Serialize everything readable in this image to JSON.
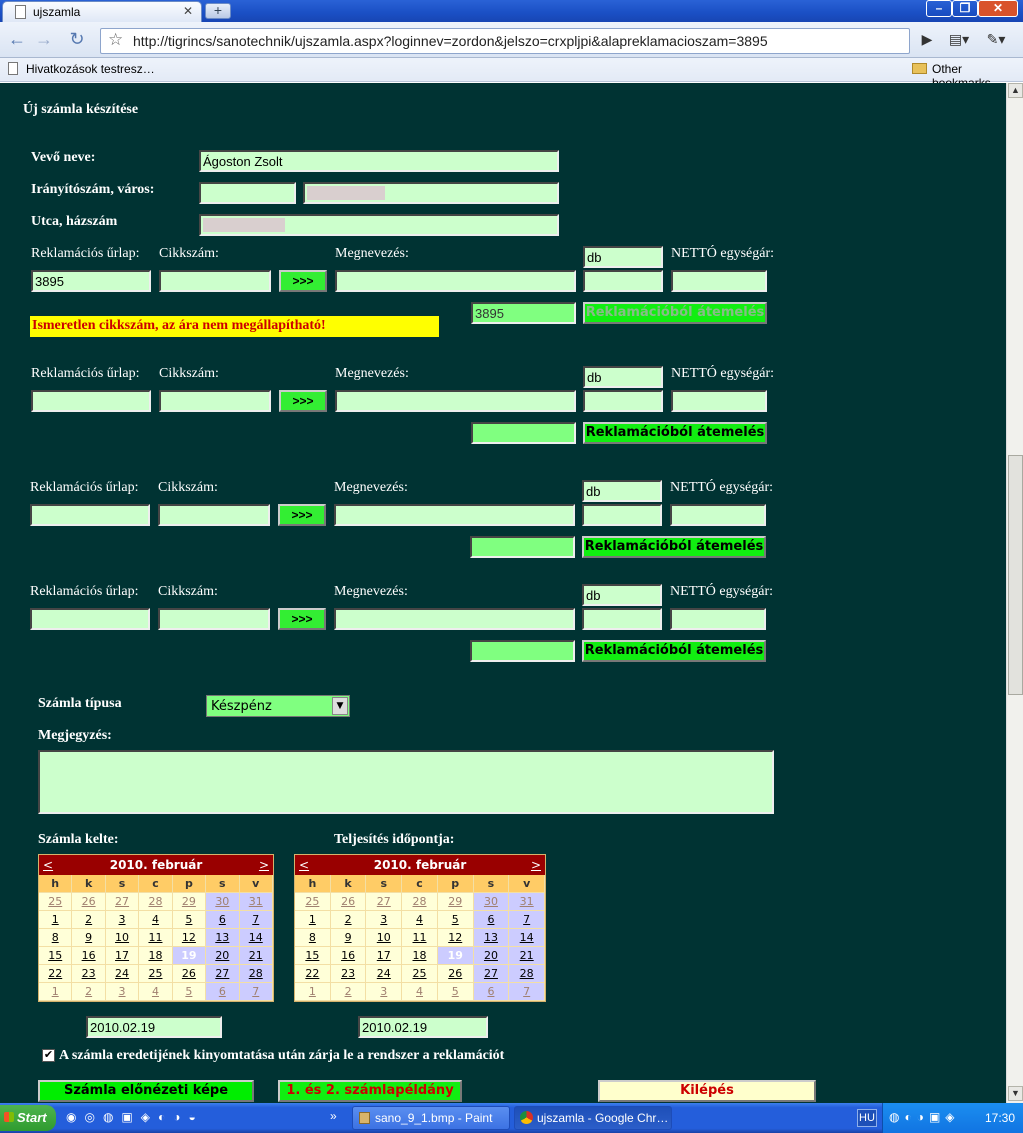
{
  "browser": {
    "tab_title": "ujszamla",
    "url": "http://tigrincs/sanotechnik/ujszamla.aspx?loginnev=zordon&jelszo=crxpljpi&alapreklamacioszam=3895",
    "bookmark_item": "Hivatkozások testresz…",
    "other_bookmarks": "Other bookmarks"
  },
  "page": {
    "title": "Új számla készítése"
  },
  "customer": {
    "name_label": "Vevő neve:",
    "name_value": "Ágoston Zsolt",
    "zip_label": "Irányítószám, város:",
    "street_label": "Utca, házszám"
  },
  "line_labels": {
    "claim": "Reklamációs űrlap:",
    "item": "Cikkszám:",
    "name": "Megnevezés:",
    "unit_price": "NETTÓ egységár:",
    "go": ">>>",
    "transfer": "Reklamációból átemelés",
    "unit": "db"
  },
  "lines": [
    {
      "claim": "3895",
      "claim_small": "3895"
    },
    {
      "claim": "",
      "claim_small": ""
    },
    {
      "claim": "",
      "claim_small": ""
    },
    {
      "claim": "",
      "claim_small": ""
    }
  ],
  "error_message": "Ismeretlen cikkszám, az ára nem megállapítható!",
  "invoice": {
    "type_label": "Számla típusa",
    "type_value": "Készpénz",
    "note_label": "Megjegyzés:",
    "issue_label": "Számla kelte:",
    "fulfil_label": "Teljesítés időpontja:",
    "issue_date": "2010.02.19",
    "fulfil_date": "2010.02.19",
    "checkbox_label": "A számla eredetijének kinyomtatása után zárja le a rendszer a reklamációt"
  },
  "calendar": {
    "month": "2010. február",
    "prev": "<",
    "next": ">",
    "dow": [
      "h",
      "k",
      "s",
      "c",
      "p",
      "s",
      "v"
    ],
    "weeks": [
      [
        "25",
        "26",
        "27",
        "28",
        "29",
        "30",
        "31"
      ],
      [
        "1",
        "2",
        "3",
        "4",
        "5",
        "6",
        "7"
      ],
      [
        "8",
        "9",
        "10",
        "11",
        "12",
        "13",
        "14"
      ],
      [
        "15",
        "16",
        "17",
        "18",
        "19",
        "20",
        "21"
      ],
      [
        "22",
        "23",
        "24",
        "25",
        "26",
        "27",
        "28"
      ],
      [
        "1",
        "2",
        "3",
        "4",
        "5",
        "6",
        "7"
      ]
    ]
  },
  "buttons": {
    "preview": "Számla előnézeti képe",
    "copies": "1. és 2. számlapéldány",
    "exit": "Kilépés"
  },
  "taskbar": {
    "start": "Start",
    "task1": "sano_9_1.bmp - Paint",
    "task2": "ujszamla - Google Chr…",
    "lang": "HU",
    "clock": "17:30"
  }
}
